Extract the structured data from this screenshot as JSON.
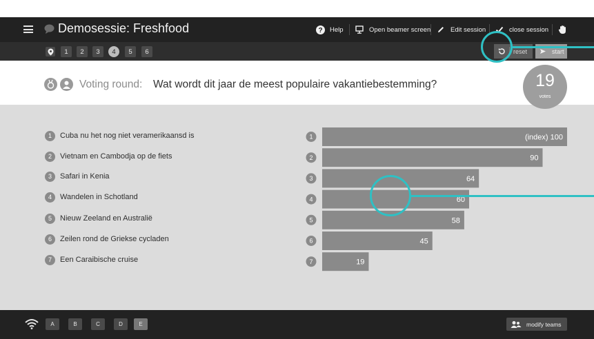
{
  "header": {
    "title": "Demosessie: Freshfood",
    "help_label": "Help",
    "beamer_label": "Open beamer screen",
    "edit_label": "Edit session",
    "close_label": "close session"
  },
  "rounds": {
    "items": [
      "1",
      "2",
      "3",
      "4",
      "5",
      "6"
    ],
    "active": "4",
    "reset_label": "reset",
    "start_label": "start"
  },
  "question": {
    "prefix": "Voting round:",
    "text": "Wat wordt dit jaar de meest populaire vakantiebestemming?",
    "votes_count": "19",
    "votes_label": "votes"
  },
  "options": [
    {
      "num": "1",
      "label": "Cuba nu het nog niet veramerikaansd is"
    },
    {
      "num": "2",
      "label": "Vietnam en Cambodja op de fiets"
    },
    {
      "num": "3",
      "label": "Safari in Kenia"
    },
    {
      "num": "4",
      "label": "Wandelen in Schotland"
    },
    {
      "num": "5",
      "label": "Nieuw Zeeland en Australië"
    },
    {
      "num": "6",
      "label": "Zeilen rond de Griekse cycladen"
    },
    {
      "num": "7",
      "label": "Een Caraibische cruise"
    }
  ],
  "chart_data": {
    "type": "bar",
    "orientation": "horizontal",
    "categories": [
      "1",
      "2",
      "3",
      "4",
      "5",
      "6",
      "7"
    ],
    "values": [
      100,
      90,
      64,
      60,
      58,
      45,
      19
    ],
    "value_labels": [
      "(index) 100",
      "90",
      "64",
      "60",
      "58",
      "45",
      "19"
    ],
    "bar_color": "#8a8a8a",
    "xlim": [
      0,
      100
    ]
  },
  "teams": {
    "items": [
      "A",
      "B",
      "C",
      "D",
      "E"
    ],
    "selected": "E",
    "modify_label": "modify teams"
  },
  "colors": {
    "topbar": "#222222",
    "subbar": "#2e2e2e",
    "panel": "#dcdcdc",
    "highlight": "#2fc0c4"
  },
  "icons": {
    "menu": "hamburger-icon",
    "help": "question-circle-icon",
    "beamer": "monitor-icon",
    "edit": "pencil-icon",
    "close": "check-icon",
    "hand": "hand-icon",
    "pin": "location-pin-icon",
    "reset": "refresh-icon",
    "start": "play-icon",
    "wifi": "wifi-icon",
    "teams": "people-icon"
  }
}
